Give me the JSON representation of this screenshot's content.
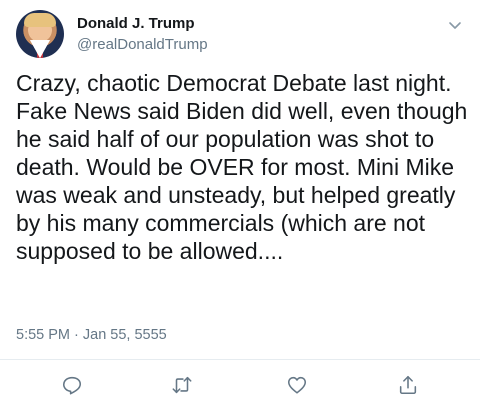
{
  "user": {
    "display_name": "Donald J. Trump",
    "handle": "@realDonaldTrump"
  },
  "tweet": {
    "text": "Crazy, chaotic Democrat Debate last night. Fake News said Biden did well, even though he said half of our population was shot to death. Would be OVER for most. Mini Mike was weak and unsteady, but helped greatly by his many commercials (which are not supposed to be allowed....",
    "timestamp": "5:55 PM · Jan 55, 5555"
  },
  "icons": {
    "menu": "chevron-down-icon",
    "reply": "reply-icon",
    "retweet": "retweet-icon",
    "like": "heart-icon",
    "share": "share-icon"
  },
  "colors": {
    "text": "#14171a",
    "secondary": "#657786",
    "icon": "#657786",
    "divider": "#e6ecf0"
  }
}
